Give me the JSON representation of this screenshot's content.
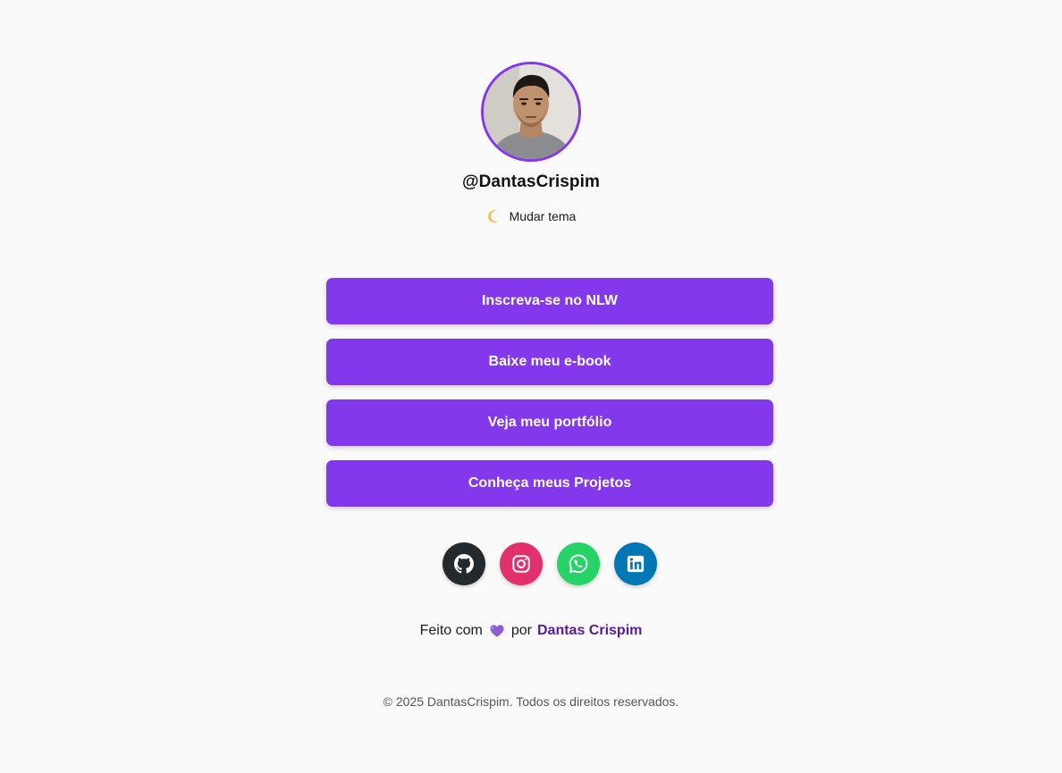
{
  "profile": {
    "username": "@DantasCrispim",
    "theme_toggle_label": "Mudar tema",
    "theme_icon": "moon-icon"
  },
  "links": [
    {
      "label": "Inscreva-se no NLW"
    },
    {
      "label": "Baixe meu e-book"
    },
    {
      "label": "Veja meu portfólio"
    },
    {
      "label": "Conheça meus Projetos"
    }
  ],
  "social": [
    {
      "icon": "github-icon",
      "color": "#24292e"
    },
    {
      "icon": "instagram-icon",
      "color": "#e1306c"
    },
    {
      "icon": "whatsapp-icon",
      "color": "#25d366"
    },
    {
      "icon": "linkedin-icon",
      "color": "#0077b5"
    }
  ],
  "footer": {
    "made_with": "Feito com",
    "heart_icon": "purple-heart-icon",
    "by": "por",
    "author": "Dantas Crispim",
    "copyright": "© 2025 DantasCrispim. Todos os direitos reservados."
  },
  "colors": {
    "accent": "#8338ec",
    "background": "#fafafa",
    "author_link": "#5a1a9c"
  }
}
